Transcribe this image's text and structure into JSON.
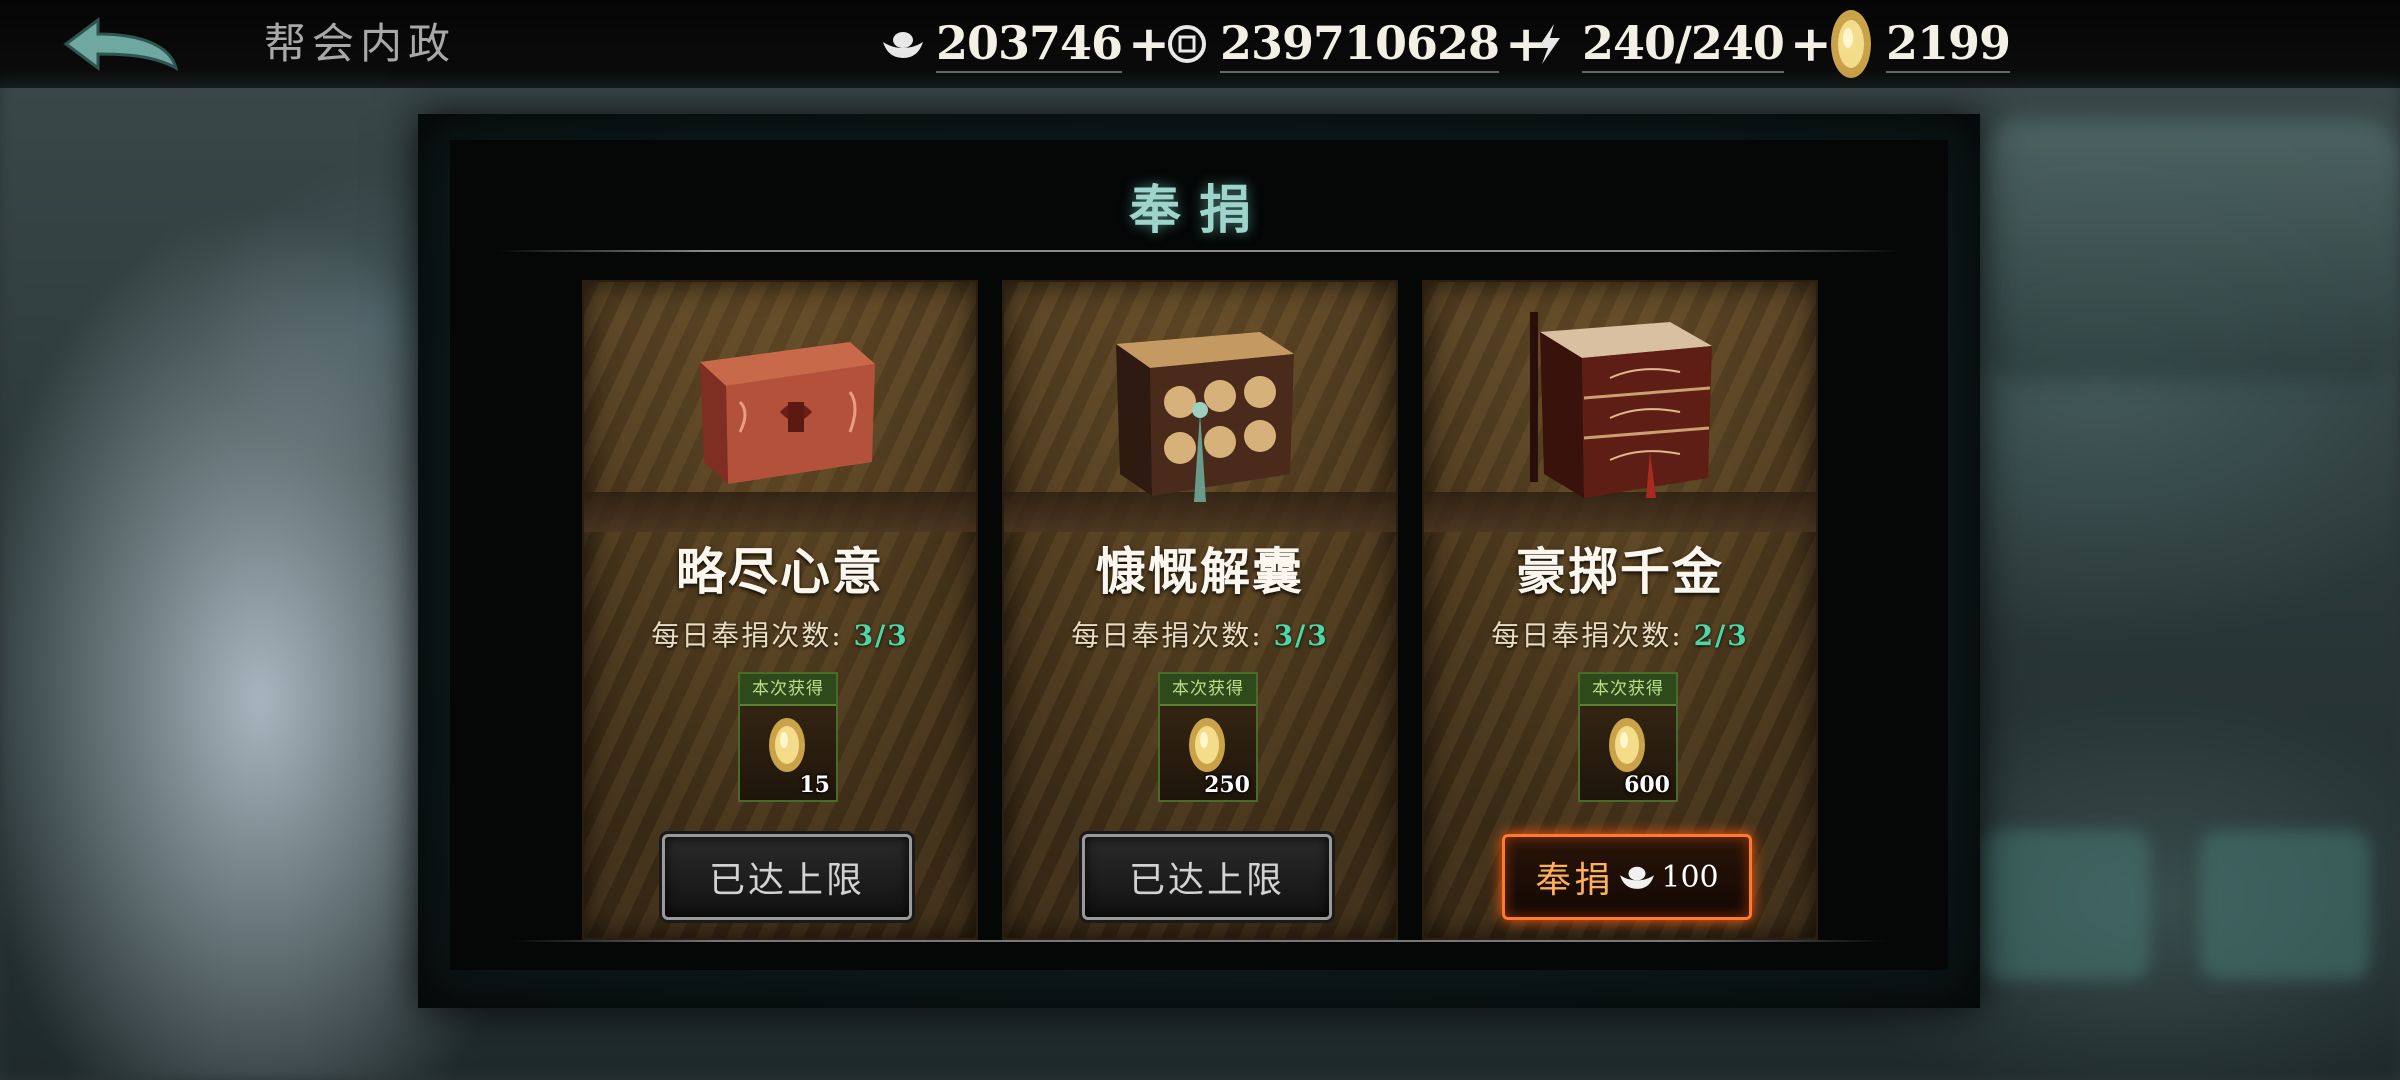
{
  "header": {
    "title": "帮会内政",
    "resources": [
      {
        "icon": "silver-ingot-icon",
        "value": "203746",
        "plus": "+"
      },
      {
        "icon": "copper-coin-icon",
        "value": "239710628",
        "plus": "+"
      },
      {
        "icon": "energy-bolt-icon",
        "value": "240/240",
        "plus": "+"
      },
      {
        "icon": "gold-token-icon",
        "value": "2199"
      }
    ]
  },
  "panel": {
    "title": "奉捐",
    "cards": [
      {
        "name": "略尽心意",
        "count_label": "每日奉捐次数:",
        "count_value": "3/3",
        "reward_tag": "本次获得",
        "reward_amount": "15",
        "button_label": "已达上限",
        "button_state": "disabled"
      },
      {
        "name": "慷慨解囊",
        "count_label": "每日奉捐次数:",
        "count_value": "3/3",
        "reward_tag": "本次获得",
        "reward_amount": "250",
        "button_label": "已达上限",
        "button_state": "disabled"
      },
      {
        "name": "豪掷千金",
        "count_label": "每日奉捐次数:",
        "count_value": "2/3",
        "reward_tag": "本次获得",
        "reward_amount": "600",
        "button_label": "奉捐",
        "button_cost": "100",
        "button_state": "active"
      }
    ]
  },
  "colors": {
    "accent_teal": "#9fd4cc",
    "count_green": "#4fd6a6",
    "active_orange": "#ff7a2a"
  }
}
